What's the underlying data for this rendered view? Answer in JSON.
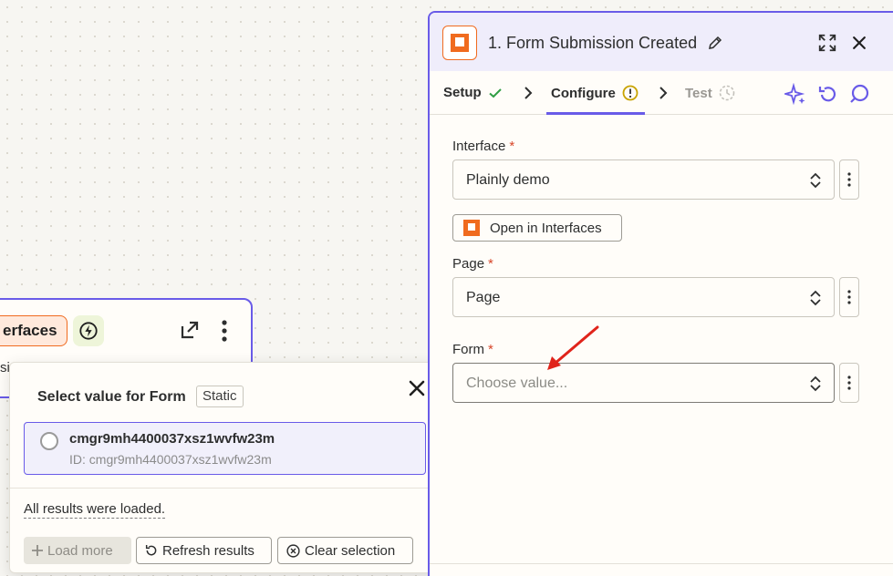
{
  "canvas_node": {
    "app_label": "erfaces",
    "sub_text": "si"
  },
  "popover": {
    "title": "Select value for Form",
    "badge": "Static",
    "options": [
      {
        "label": "cmgr9mh4400037xsz1wvfw23m",
        "id_text": "ID: cmgr9mh4400037xsz1wvfw23m"
      }
    ],
    "status": "All results were loaded.",
    "load_more_label": "Load more",
    "refresh_label": "Refresh results",
    "clear_label": "Clear selection"
  },
  "panel": {
    "title": "1. Form Submission Created",
    "tabs": [
      {
        "label": "Setup"
      },
      {
        "label": "Configure"
      },
      {
        "label": "Test"
      }
    ],
    "fields": {
      "interface": {
        "label": "Interface",
        "value": "Plainly demo"
      },
      "open_button": "Open in Interfaces",
      "page": {
        "label": "Page",
        "value": "Page"
      },
      "form": {
        "label": "Form",
        "placeholder": "Choose value..."
      }
    },
    "required_marker": "*"
  },
  "colors": {
    "accent": "#695be8",
    "brand_orange": "#f06b1f",
    "success": "#2f9e44",
    "warning": "#c9a400",
    "required": "#d7462a",
    "annotation": "#e0241b"
  },
  "icons": {
    "app": "interfaces-logo-icon",
    "trigger": "lightning-icon",
    "open_external": "external-link-icon",
    "more": "more-vertical-icon",
    "edit": "pencil-icon",
    "expand": "expand-icon",
    "close": "close-icon",
    "check": "check-icon",
    "warning": "warning-circle-icon",
    "clock": "clock-icon",
    "ai": "sparkle-icon",
    "undo": "undo-icon",
    "comment": "comment-icon",
    "chevron": "chevron-up-down-icon"
  }
}
